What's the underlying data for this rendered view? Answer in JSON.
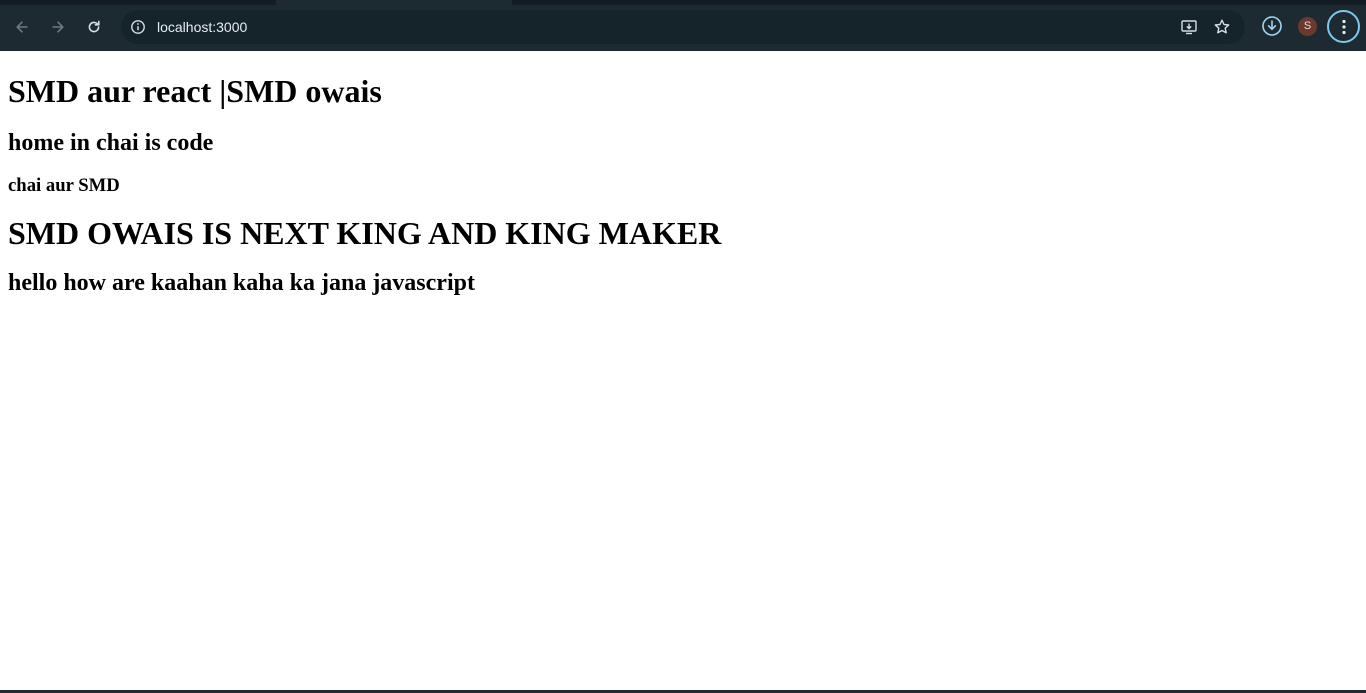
{
  "browser": {
    "url": "localhost:3000",
    "profile_initial": "S",
    "icons": {
      "back": "back-arrow-icon",
      "forward": "forward-arrow-icon",
      "reload": "reload-icon",
      "site_info": "info-icon",
      "install": "install-app-icon",
      "bookmark": "star-icon",
      "download": "download-icon",
      "menu": "kebab-menu-icon"
    },
    "colors": {
      "chrome": "#1e2a32",
      "omnibox": "#15232b",
      "accent": "#7ec8ef"
    }
  },
  "page": {
    "heading1": "SMD aur react |SMD owais",
    "heading2": "home in chai is code",
    "heading3": "chai aur SMD",
    "heading4": "SMD OWAIS IS NEXT KING AND KING MAKER",
    "heading5": "hello how are kaahan kaha ka jana javascript"
  }
}
